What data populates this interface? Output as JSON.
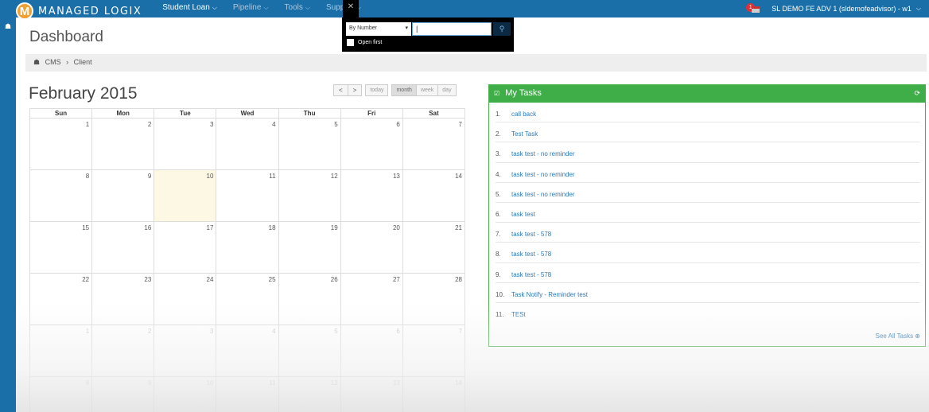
{
  "app": {
    "logo_letter": "M",
    "name": "MANAGED LOGIX"
  },
  "nav": {
    "items": [
      {
        "label": "Student Loan",
        "caret": "⌵"
      },
      {
        "label": "Pipeline",
        "caret": "⌵"
      },
      {
        "label": "Tools",
        "caret": "⌵"
      },
      {
        "label": "Support",
        "caret": "⌵"
      }
    ],
    "close": "✕"
  },
  "user": {
    "notification_count": "1",
    "label": "SL DEMO FE ADV 1 (sldemofeadvisor) - w1",
    "caret": "⌵"
  },
  "search": {
    "mode": "By Number",
    "mode_caret": "▾",
    "value": "|",
    "button": "⚲",
    "open_first_label": "Open first"
  },
  "sidebar": {
    "home_icon": "☗"
  },
  "page": {
    "title": "Dashboard"
  },
  "breadcrumb": {
    "home_icon": "☗",
    "item1": "CMS",
    "sep": "›",
    "item2": "Client"
  },
  "calendar": {
    "title": "February 2015",
    "prev": "<",
    "next": ">",
    "today": "today",
    "month": "month",
    "week": "week",
    "day": "day",
    "days": [
      "Sun",
      "Mon",
      "Tue",
      "Wed",
      "Thu",
      "Fri",
      "Sat"
    ],
    "weeks": [
      [
        "1",
        "2",
        "3",
        "4",
        "5",
        "6",
        "7"
      ],
      [
        "8",
        "9",
        "10",
        "11",
        "12",
        "13",
        "14"
      ],
      [
        "15",
        "16",
        "17",
        "18",
        "19",
        "20",
        "21"
      ],
      [
        "22",
        "23",
        "24",
        "25",
        "26",
        "27",
        "28"
      ],
      [
        "1",
        "2",
        "3",
        "4",
        "5",
        "6",
        "7"
      ],
      [
        "8",
        "9",
        "10",
        "11",
        "12",
        "13",
        "14"
      ]
    ]
  },
  "tasks": {
    "title": "My Tasks",
    "title_icon": "☑",
    "refresh_icon": "⟳",
    "items": [
      {
        "num": "1.",
        "label": "call back"
      },
      {
        "num": "2.",
        "label": "Test Task"
      },
      {
        "num": "3.",
        "label": "task test - no reminder"
      },
      {
        "num": "4.",
        "label": "task test - no reminder"
      },
      {
        "num": "5.",
        "label": "task test - no reminder"
      },
      {
        "num": "6.",
        "label": "task test"
      },
      {
        "num": "7.",
        "label": "task test - 578"
      },
      {
        "num": "8.",
        "label": "task test - 578"
      },
      {
        "num": "9.",
        "label": "task test - 578"
      },
      {
        "num": "10.",
        "label": "Task Notify - Reminder test"
      },
      {
        "num": "11.",
        "label": "TESt"
      }
    ],
    "see_all": "See All Tasks ⊕"
  }
}
